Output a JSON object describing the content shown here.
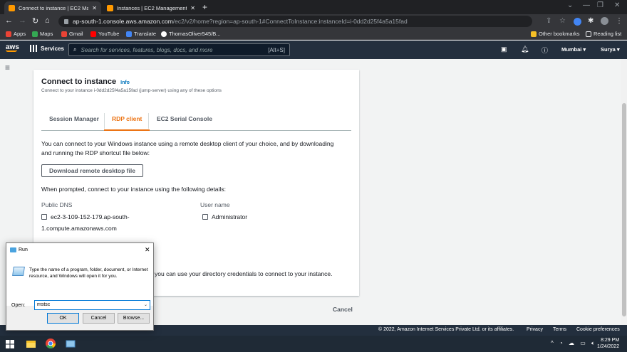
{
  "browser": {
    "tabs": [
      {
        "label": "Connect to instance | EC2 Manag",
        "active": true
      },
      {
        "label": "Instances | EC2 Management Co",
        "active": false
      }
    ],
    "new_tab": "+",
    "url_host": "ap-south-1.console.aws.amazon.com",
    "url_path": "/ec2/v2/home?region=ap-south-1#ConnectToInstance:instanceId=i-0dd2d25f4a5a15fad",
    "bookmarks": [
      {
        "label": "Apps",
        "color": "#ea4335"
      },
      {
        "label": "Maps",
        "color": "#34a853"
      },
      {
        "label": "Gmail",
        "color": "#ea4335"
      },
      {
        "label": "YouTube",
        "color": "#ff0000"
      },
      {
        "label": "Translate",
        "color": "#4285f4"
      },
      {
        "label": "ThomasOliver545/B...",
        "color": "#ffffff"
      }
    ],
    "other_bookmarks": "Other bookmarks",
    "reading_list": "Reading list"
  },
  "aws_nav": {
    "logo": "aws",
    "services": "Services",
    "search_placeholder": "Search for services, features, blogs, docs, and more",
    "search_shortcut": "[Alt+S]",
    "region": "Mumbai ▾",
    "user": "Surya ▾"
  },
  "card": {
    "title": "Connect to instance",
    "info": "Info",
    "subtitle": "Connect to your instance i-0dd2d25f4a5a15fad (jump-server) using any of these options",
    "tabs": [
      "Session Manager",
      "RDP client",
      "EC2 Serial Console"
    ],
    "intro": "You can connect to your Windows instance using a remote desktop client of your choice, and by downloading and running the RDP shortcut file below:",
    "download_button": "Download remote desktop file",
    "prompt": "When prompted, connect to your instance using the following details:",
    "public_dns_label": "Public DNS",
    "public_dns_value": "ec2-3-109-152-179.ap-south-1.compute.amazonaws.com",
    "username_label": "User name",
    "username_value": "Administrator",
    "directory_note": "you can use your directory credentials to connect to your instance.",
    "cancel": "Cancel"
  },
  "footer": {
    "copyright": "© 2022, Amazon Internet Services Private Ltd. or its affiliates.",
    "privacy": "Privacy",
    "terms": "Terms",
    "cookies": "Cookie preferences"
  },
  "run_dialog": {
    "title": "Run",
    "description": "Type the name of a program, folder, document, or Internet resource, and Windows will open it for you.",
    "open_label": "Open:",
    "open_value": "mstsc",
    "ok": "OK",
    "cancel": "Cancel",
    "browse": "Browse..."
  },
  "taskbar": {
    "time": "8:29 PM",
    "date": "1/24/2022"
  }
}
